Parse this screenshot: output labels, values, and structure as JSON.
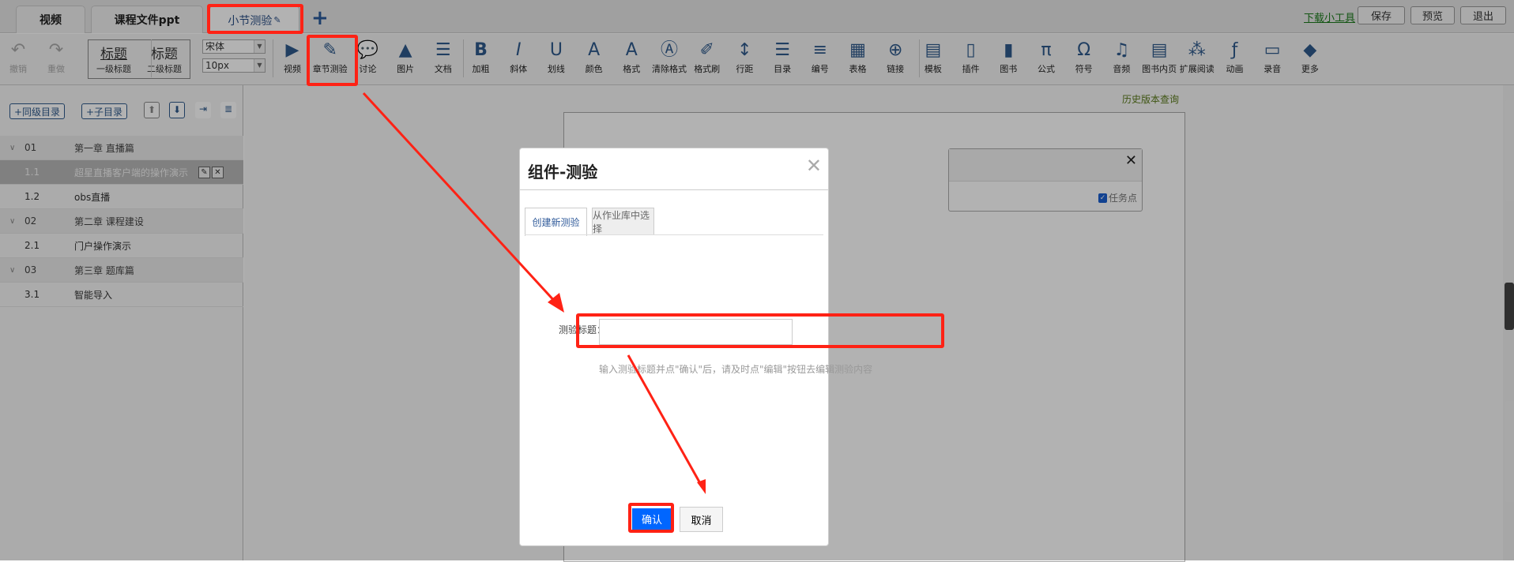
{
  "tabs": [
    {
      "label": "视频"
    },
    {
      "label": "课程文件ppt"
    },
    {
      "label": "小节测验",
      "active": true
    }
  ],
  "add_tab": "+",
  "edit_icon": "✎",
  "top_actions": {
    "download": "下载小工具",
    "save": "保存",
    "preview": "预览",
    "exit": "退出"
  },
  "toolbar": {
    "undo": "撤销",
    "redo": "重做",
    "heading1": {
      "big": "标题",
      "small": "一级标题"
    },
    "heading2": {
      "big": "标题",
      "small": "二级标题"
    },
    "font_family": "宋体",
    "font_size": "10px",
    "items": [
      {
        "label": "视频",
        "icon": "video-icon"
      },
      {
        "label": "章节测验",
        "icon": "quiz-icon"
      },
      {
        "label": "讨论",
        "icon": "discussion-icon"
      },
      {
        "label": "图片",
        "icon": "image-icon"
      },
      {
        "label": "文档",
        "icon": "document-icon"
      },
      {
        "label": "加粗",
        "icon": "bold-icon"
      },
      {
        "label": "斜体",
        "icon": "italic-icon"
      },
      {
        "label": "划线",
        "icon": "underline-icon"
      },
      {
        "label": "颜色",
        "icon": "font-color-icon"
      },
      {
        "label": "格式",
        "icon": "format-icon"
      },
      {
        "label": "清除格式",
        "icon": "clear-format-icon"
      },
      {
        "label": "格式刷",
        "icon": "format-painter-icon"
      },
      {
        "label": "行距",
        "icon": "line-height-icon"
      },
      {
        "label": "目录",
        "icon": "list-icon"
      },
      {
        "label": "编号",
        "icon": "numbered-list-icon"
      },
      {
        "label": "表格",
        "icon": "table-icon"
      },
      {
        "label": "链接",
        "icon": "link-icon"
      },
      {
        "label": "模板",
        "icon": "template-icon"
      },
      {
        "label": "插件",
        "icon": "plugin-icon"
      },
      {
        "label": "图书",
        "icon": "book-icon"
      },
      {
        "label": "公式",
        "icon": "formula-icon"
      },
      {
        "label": "符号",
        "icon": "symbol-icon"
      },
      {
        "label": "音频",
        "icon": "audio-icon"
      },
      {
        "label": "图书内页",
        "icon": "book-page-icon"
      },
      {
        "label": "扩展阅读",
        "icon": "extended-reading-icon"
      },
      {
        "label": "动画",
        "icon": "animation-icon"
      },
      {
        "label": "录音",
        "icon": "recording-icon"
      },
      {
        "label": "更多",
        "icon": "more-icon"
      }
    ]
  },
  "sidebar": {
    "add_sibling": "+同级目录",
    "add_child": "+子目录",
    "rows": [
      {
        "num": "01",
        "title": "第一章 直播篇",
        "type": "chapter"
      },
      {
        "num": "1.1",
        "title": "超星直播客户端的操作演示",
        "type": "selected"
      },
      {
        "num": "1.2",
        "title": "obs直播",
        "type": "section"
      },
      {
        "num": "02",
        "title": "第二章 课程建设",
        "type": "chapter"
      },
      {
        "num": "2.1",
        "title": "门户操作演示",
        "type": "section"
      },
      {
        "num": "03",
        "title": "第三章 题库篇",
        "type": "chapter"
      },
      {
        "num": "3.1",
        "title": "智能导入",
        "type": "section"
      }
    ]
  },
  "history_link": "历史版本查询",
  "widget": {
    "task_point": "任务点",
    "task_checked": true
  },
  "dialog": {
    "title": "组件-测验",
    "tabs": [
      "创建新测验",
      "从作业库中选择"
    ],
    "field_label": "测验标题：",
    "field_value": "",
    "hint": "输入测验标题并点\"确认\"后，请及时点\"编辑\"按钮去编辑测验内容",
    "confirm": "确认",
    "cancel": "取消"
  },
  "colors": {
    "accent": "#0066ff",
    "annotation": "#ff2215",
    "brand": "#2f5a8c"
  }
}
